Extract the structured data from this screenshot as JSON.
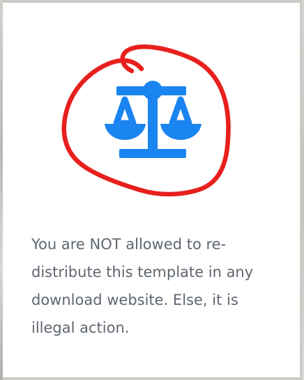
{
  "card": {
    "icon": "balance-scale-icon",
    "annotation": "red-hand-drawn-circle",
    "icon_color": "#1a84f0",
    "annotation_color": "#e8201d",
    "notice_text": "You are NOT allowed to re-distribute this template in any download website. Else, it is illegal action."
  }
}
